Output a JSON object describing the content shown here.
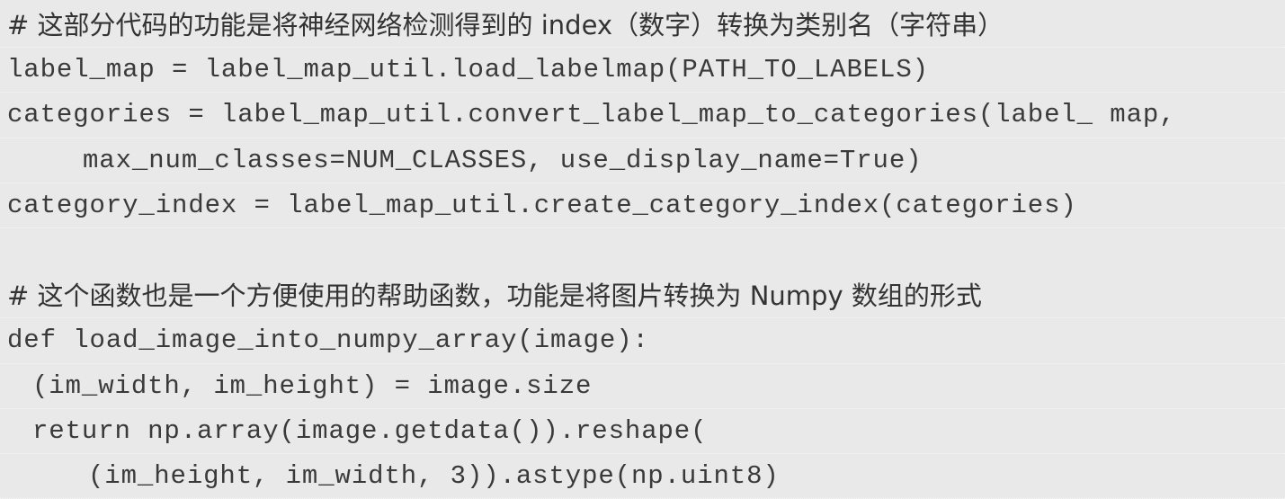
{
  "code": {
    "lines": [
      "# 这部分代码的功能是将神经网络检测得到的 index（数字）转换为类别名（字符串）",
      "label_map = label_map_util.load_labelmap(PATH_TO_LABELS)",
      "categories = label_map_util.convert_label_map_to_categories(label_ map,",
      "max_num_classes=NUM_CLASSES, use_display_name=True)",
      "category_index = label_map_util.create_category_index(categories)",
      "",
      "# 这个函数也是一个方便使用的帮助函数，功能是将图片转换为 Numpy 数组的形式",
      "def load_image_into_numpy_array(image):",
      "(im_width, im_height) = image.size",
      "return np.array(image.getdata()).reshape(",
      "(im_height, im_width, 3)).astype(np.uint8)"
    ]
  }
}
